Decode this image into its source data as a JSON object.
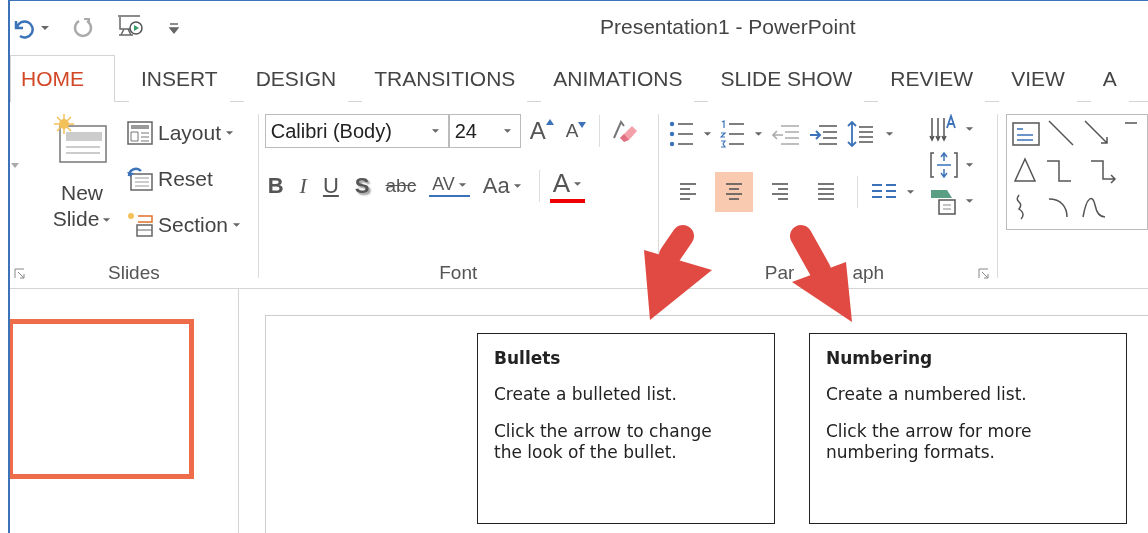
{
  "window": {
    "title": "Presentation1 - PowerPoint"
  },
  "tabs": [
    {
      "label": "HOME",
      "selected": true
    },
    {
      "label": "INSERT",
      "selected": false
    },
    {
      "label": "DESIGN",
      "selected": false
    },
    {
      "label": "TRANSITIONS",
      "selected": false
    },
    {
      "label": "ANIMATIONS",
      "selected": false
    },
    {
      "label": "SLIDE SHOW",
      "selected": false
    },
    {
      "label": "REVIEW",
      "selected": false
    },
    {
      "label": "VIEW",
      "selected": false
    },
    {
      "label": "A",
      "selected": false
    }
  ],
  "slides_group": {
    "label": "Slides",
    "new_slide": "New Slide",
    "commands": [
      {
        "kind": "layout",
        "label": "Layout"
      },
      {
        "kind": "reset",
        "label": "Reset"
      },
      {
        "kind": "section",
        "label": "Section"
      }
    ]
  },
  "font_group": {
    "label": "Font",
    "font_name": "Calibri (Body)",
    "font_size": "24",
    "grow": "A",
    "shrink": "A",
    "formats": [
      {
        "label": "B",
        "kind": "bold"
      },
      {
        "label": "I",
        "kind": "italic"
      },
      {
        "label": "U",
        "kind": "underline"
      },
      {
        "label": "S",
        "kind": "shadow"
      },
      {
        "label": "abc",
        "kind": "strike"
      },
      {
        "label": "AV",
        "kind": "spacing"
      },
      {
        "label": "Aa",
        "kind": "case"
      }
    ],
    "font_color": "A"
  },
  "paragraph_group": {
    "label_parts": [
      "Par",
      "aph"
    ],
    "alignments": [
      {
        "kind": "left",
        "selected": false
      },
      {
        "kind": "center",
        "selected": true
      },
      {
        "kind": "right",
        "selected": false
      },
      {
        "kind": "justify",
        "selected": false
      }
    ]
  },
  "thumbnails": [
    {
      "selected": true
    }
  ],
  "tooltips": [
    {
      "title": "Bullets",
      "lines": [
        "Create a bulleted list.",
        "Click the arrow to change the look of the bullet."
      ]
    },
    {
      "title": "Numbering",
      "lines": [
        "Create a numbered list.",
        "Click the arrow for more numbering formats."
      ]
    }
  ]
}
